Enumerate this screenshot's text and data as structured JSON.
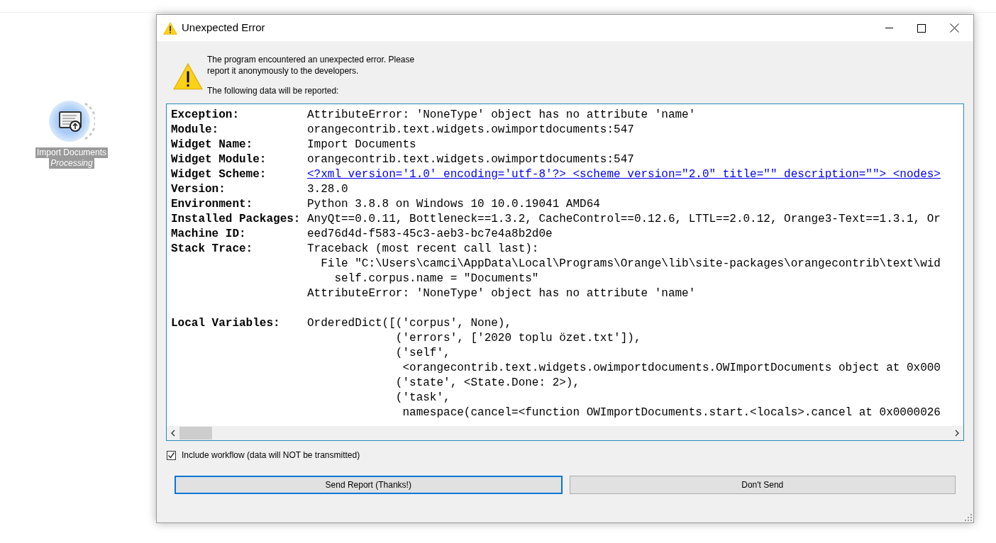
{
  "canvas_node": {
    "label": "Import Documents",
    "status": "Processing"
  },
  "dialog": {
    "title": "Unexpected Error",
    "message": [
      "The program encountered an unexpected error. Please report it anonymously to the developers.",
      "The following data will be reported:"
    ],
    "report": [
      {
        "label": "Exception:",
        "kind": "text",
        "lines": [
          "AttributeError: 'NoneType' object has no attribute 'name'"
        ]
      },
      {
        "label": "Module:",
        "kind": "text",
        "lines": [
          "orangecontrib.text.widgets.owimportdocuments:547"
        ]
      },
      {
        "label": "Widget Name:",
        "kind": "text",
        "lines": [
          "Import Documents"
        ]
      },
      {
        "label": "Widget Module:",
        "kind": "text",
        "lines": [
          "orangecontrib.text.widgets.owimportdocuments:547"
        ]
      },
      {
        "label": "Widget Scheme:",
        "kind": "link",
        "lines": [
          "<?xml version='1.0' encoding='utf-8'?> <scheme version=\"2.0\" title=\"\" description=\"\"> <nodes>"
        ]
      },
      {
        "label": "Version:",
        "kind": "text",
        "lines": [
          "3.28.0"
        ]
      },
      {
        "label": "Environment:",
        "kind": "text",
        "lines": [
          "Python 3.8.8 on Windows 10 10.0.19041 AMD64"
        ]
      },
      {
        "label": "Installed Packages:",
        "kind": "text",
        "lines": [
          "AnyQt==0.0.11, Bottleneck==1.3.2, CacheControl==0.12.6, LTTL==2.0.12, Orange3-Text==1.3.1, Or"
        ]
      },
      {
        "label": "Machine ID:",
        "kind": "text",
        "lines": [
          "eed76d4d-f583-45c3-aeb3-bc7e4a8b2d0e"
        ]
      },
      {
        "label": "Stack Trace:",
        "kind": "text",
        "lines": [
          "Traceback (most recent call last):",
          "  File \"C:\\Users\\camci\\AppData\\Local\\Programs\\Orange\\lib\\site-packages\\orangecontrib\\text\\wid",
          "    self.corpus.name = \"Documents\"",
          "AttributeError: 'NoneType' object has no attribute 'name'"
        ]
      }
    ],
    "report_locals": [
      {
        "label": "Local Variables:",
        "kind": "text",
        "lines": [
          "OrderedDict([('corpus', None),",
          "             ('errors', ['2020 toplu özet.txt']),",
          "             ('self',",
          "              <orangecontrib.text.widgets.owimportdocuments.OWImportDocuments object at 0x000",
          "             ('state', <State.Done: 2>),",
          "             ('task',",
          "              namespace(cancel=<function OWImportDocuments.start.<locals>.cancel at 0x0000026"
        ]
      }
    ],
    "include_workflow": {
      "label": "Include workflow (data will NOT be transmitted)",
      "checked": true
    },
    "buttons": [
      {
        "label": "Send Report (Thanks!)",
        "default": true
      },
      {
        "label": "Don't Send",
        "default": false
      }
    ]
  }
}
